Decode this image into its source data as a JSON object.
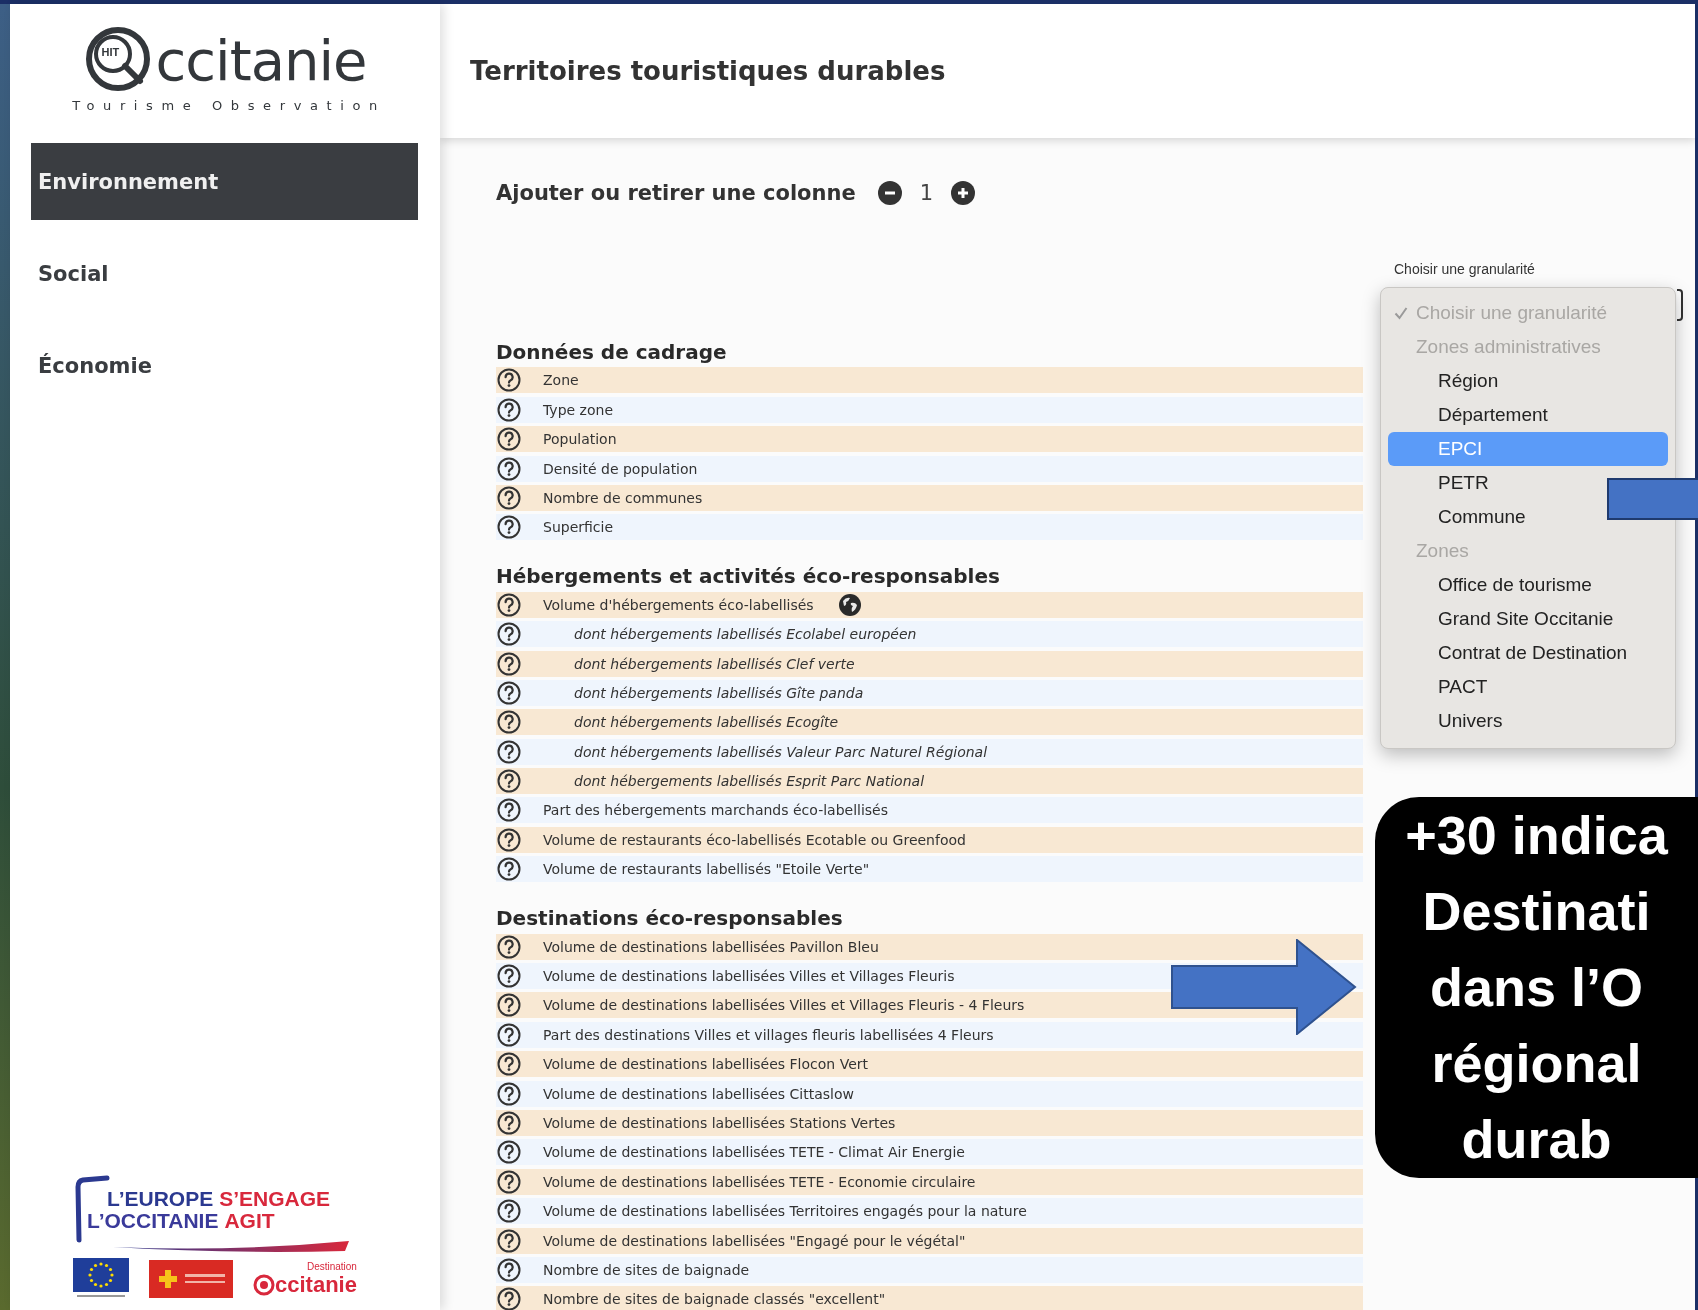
{
  "sidebar": {
    "logo": {
      "badge": "HIT",
      "wordmark": "ccitanie",
      "tagline": "Tourisme Observation"
    },
    "nav": [
      {
        "label": "Environnement",
        "selected": true
      },
      {
        "label": "Social",
        "selected": false
      },
      {
        "label": "Économie",
        "selected": false
      }
    ],
    "partners": {
      "lines": [
        [
          {
            "text": "L’EUROPE",
            "color": "#2b3990"
          },
          {
            "text": "S’ENGAGE",
            "color": "#d8283c"
          }
        ],
        [
          {
            "text": "L’OCCITANIE",
            "color": "#3a3a9a"
          },
          {
            "text": "AGIT",
            "color": "#d8283c"
          }
        ]
      ],
      "destination": {
        "caption": "Destination",
        "wordmark": "ccitanie"
      }
    }
  },
  "header": {
    "title": "Territoires touristiques durables"
  },
  "toolbar": {
    "label": "Ajouter ou retirer une colonne",
    "count": "1"
  },
  "granularity": {
    "label": "Choisir une granularité",
    "menu": [
      {
        "label": "Choisir une granularité",
        "kind": "placeholder",
        "checked": true,
        "selected": false,
        "disabled": true
      },
      {
        "label": "Zones administratives",
        "kind": "group",
        "checked": false,
        "selected": false,
        "disabled": true
      },
      {
        "label": "Région",
        "kind": "option",
        "checked": false,
        "selected": false,
        "disabled": false
      },
      {
        "label": "Département",
        "kind": "option",
        "checked": false,
        "selected": false,
        "disabled": false
      },
      {
        "label": "EPCI",
        "kind": "option",
        "checked": false,
        "selected": true,
        "disabled": false
      },
      {
        "label": "PETR",
        "kind": "option",
        "checked": false,
        "selected": false,
        "disabled": false
      },
      {
        "label": "Commune",
        "kind": "option",
        "checked": false,
        "selected": false,
        "disabled": false
      },
      {
        "label": "Zones",
        "kind": "group",
        "checked": false,
        "selected": false,
        "disabled": true
      },
      {
        "label": "Office de tourisme",
        "kind": "option",
        "checked": false,
        "selected": false,
        "disabled": false
      },
      {
        "label": "Grand Site Occitanie",
        "kind": "option",
        "checked": false,
        "selected": false,
        "disabled": false
      },
      {
        "label": "Contrat de Destination",
        "kind": "option",
        "checked": false,
        "selected": false,
        "disabled": false
      },
      {
        "label": "PACT",
        "kind": "option",
        "checked": false,
        "selected": false,
        "disabled": false
      },
      {
        "label": "Univers",
        "kind": "option",
        "checked": false,
        "selected": false,
        "disabled": false
      }
    ]
  },
  "sections": [
    {
      "title": "Données de cadrage",
      "rows": [
        {
          "label": "Zone",
          "globe": false
        },
        {
          "label": "Type zone",
          "globe": false
        },
        {
          "label": "Population",
          "globe": false
        },
        {
          "label": "Densité de population",
          "globe": false
        },
        {
          "label": "Nombre de communes",
          "globe": false
        },
        {
          "label": "Superficie",
          "globe": false
        }
      ]
    },
    {
      "title": "Hébergements et activités éco-responsables",
      "rows": [
        {
          "label": "Volume d'hébergements éco-labellisés",
          "globe": true,
          "children": [
            {
              "label": "dont hébergements labellisés Ecolabel européen",
              "globe": false
            },
            {
              "label": "dont hébergements labellisés Clef verte",
              "globe": false
            },
            {
              "label": "dont hébergements labellisés Gîte panda",
              "globe": false
            },
            {
              "label": "dont hébergements labellisés Ecogîte",
              "globe": false
            },
            {
              "label": "dont hébergements labellisés Valeur Parc Naturel Régional",
              "globe": false
            },
            {
              "label": "dont hébergements labellisés Esprit Parc National",
              "globe": false
            }
          ]
        },
        {
          "label": "Part des hébergements marchands éco-labellisés",
          "globe": false
        },
        {
          "label": "Volume de restaurants éco-labellisés Ecotable ou Greenfood",
          "globe": false
        },
        {
          "label": "Volume de restaurants labellisés \"Etoile Verte\"",
          "globe": false
        }
      ]
    },
    {
      "title": "Destinations éco-responsables",
      "rows": [
        {
          "label": "Volume de destinations labellisées Pavillon Bleu",
          "globe": false
        },
        {
          "label": "Volume de destinations labellisées Villes et Villages Fleuris",
          "globe": false
        },
        {
          "label": "Volume de destinations labellisées Villes et Villages Fleuris - 4 Fleurs",
          "globe": false
        },
        {
          "label": "Part des destinations Villes et villages fleuris labellisées 4 Fleurs",
          "globe": false
        },
        {
          "label": "Volume de destinations labellisées Flocon Vert",
          "globe": false
        },
        {
          "label": "Volume de destinations labellisées Cittaslow",
          "globe": false
        },
        {
          "label": "Volume de destinations labellisées Stations Vertes",
          "globe": false
        },
        {
          "label": "Volume de destinations labellisées TETE - Climat Air Energie",
          "globe": false
        },
        {
          "label": "Volume de destinations labellisées TETE - Economie circulaire",
          "globe": false
        },
        {
          "label": "Volume de destinations labellisées Territoires engagés pour la nature",
          "globe": false
        },
        {
          "label": "Volume de destinations labellisées \"Engagé pour le végétal\"",
          "globe": false
        },
        {
          "label": "Nombre de sites de baignade",
          "globe": false
        },
        {
          "label": "Nombre de sites de baignade classés \"excellent\"",
          "globe": false
        }
      ]
    }
  ],
  "callout": {
    "lines": [
      "+30 indica",
      "Destinati",
      "dans l’O",
      "régional",
      "durab"
    ]
  }
}
